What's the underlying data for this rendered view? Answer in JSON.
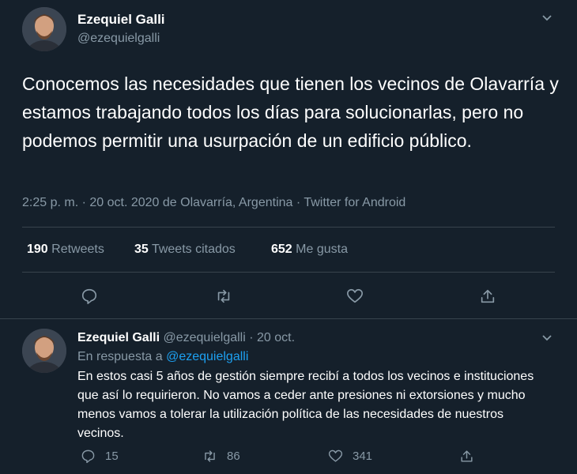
{
  "tweet": {
    "author_name": "Ezequiel Galli",
    "author_handle": "@ezequielgalli",
    "text": "Conocemos las necesidades que tienen los vecinos de Olavarría y estamos trabajando todos los días para solucionarlas, pero no podemos permitir una usurpación de un edificio público.",
    "meta": "2:25 p. m. · 20 oct. 2020 de Olavarría, Argentina · Twitter for Android",
    "retweets_count": "190",
    "retweets_label": "Retweets",
    "quotes_count": "35",
    "quotes_label": "Tweets citados",
    "likes_count": "652",
    "likes_label": "Me gusta"
  },
  "reply": {
    "author_name": "Ezequiel Galli",
    "author_handle": "@ezequielgalli",
    "separator": "·",
    "date": "20 oct.",
    "in_reply_prefix": "En respuesta a",
    "in_reply_handle": "@ezequielgalli",
    "text": "En estos casi 5 años de gestión siempre recibí a todos los vecinos e instituciones que así lo requirieron. No vamos a ceder ante presiones ni extorsiones y mucho menos vamos a tolerar la utilización política de las necesidades de nuestros vecinos.",
    "reply_count": "15",
    "retweet_count": "86",
    "like_count": "341"
  },
  "colors": {
    "background": "#15202b",
    "secondary_text": "#8899a6",
    "link": "#1da1f2",
    "divider": "#38444d"
  }
}
